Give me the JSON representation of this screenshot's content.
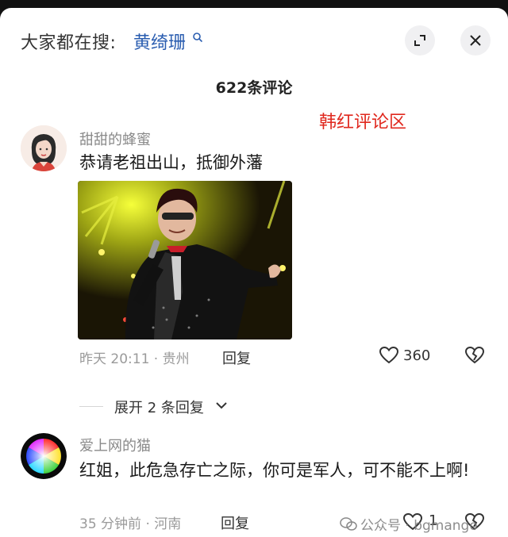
{
  "header": {
    "search_prefix": "大家都在搜:",
    "search_term": "黄绮珊"
  },
  "comments_header": {
    "count_label": "622条评论"
  },
  "overlay_caption": "韩红评论区",
  "comments": [
    {
      "username": "甜甜的蜂蜜",
      "text": "恭请老祖出山，抵御外藩",
      "meta": "昨天 20:11 · 贵州",
      "reply_label": "回复",
      "likes": "360",
      "expand_label": "展开 2 条回复"
    },
    {
      "username": "爱上网的猫",
      "text": "红姐，此危急存亡之际，你可是军人，可不能不上啊!",
      "meta": "35 分钟前 · 河南",
      "reply_label": "回复",
      "likes": "1"
    }
  ],
  "watermark": {
    "text": "公众号 · bgmango"
  },
  "icons": {
    "expand": "expand-icon",
    "close": "close-icon",
    "like": "heart-icon",
    "dislike": "broken-heart-icon",
    "search": "search-icon"
  },
  "colors": {
    "link_blue": "#2a5db0",
    "caption_red": "#e0281e"
  }
}
